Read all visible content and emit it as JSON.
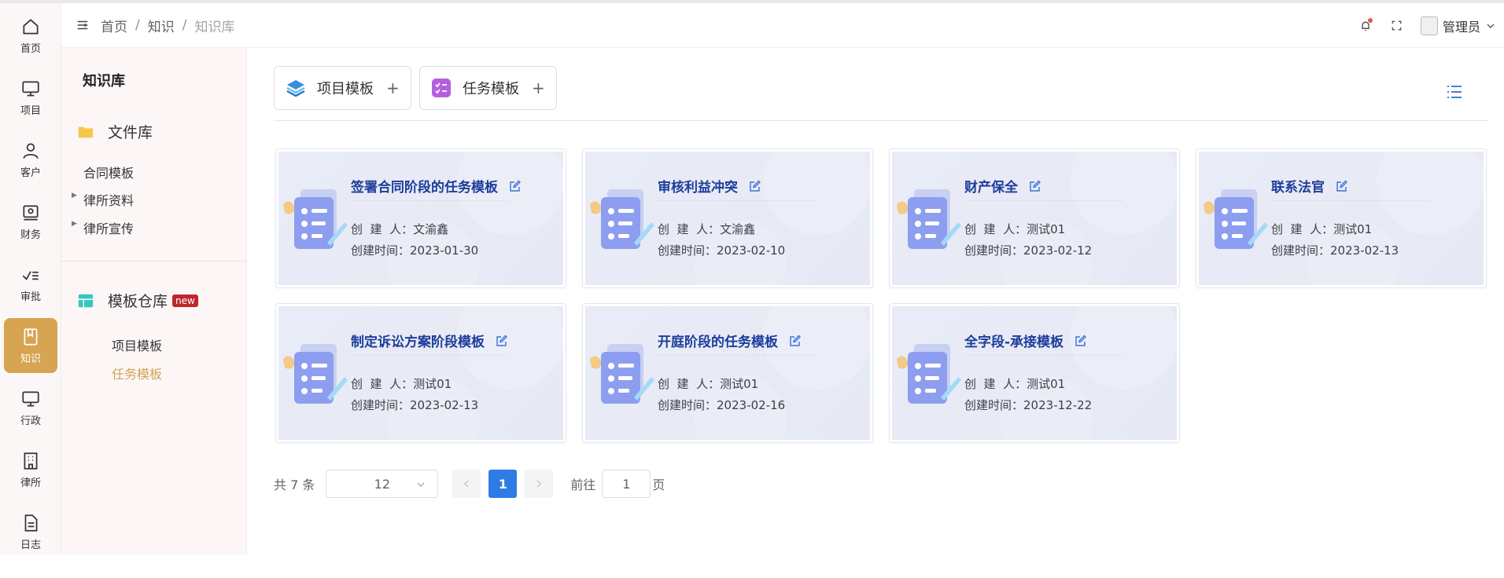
{
  "rail": [
    {
      "label": "首页",
      "icon": "home-icon"
    },
    {
      "label": "项目",
      "icon": "monitor-icon"
    },
    {
      "label": "客户",
      "icon": "user-icon"
    },
    {
      "label": "财务",
      "icon": "finance-icon"
    },
    {
      "label": "审批",
      "icon": "approval-icon"
    },
    {
      "label": "知识",
      "icon": "book-icon",
      "active": true
    },
    {
      "label": "行政",
      "icon": "monitor-icon"
    },
    {
      "label": "律所",
      "icon": "building-icon"
    },
    {
      "label": "日志",
      "icon": "document-icon"
    }
  ],
  "breadcrumb": {
    "items": [
      "首页",
      "知识",
      "知识库"
    ],
    "separator": "/"
  },
  "header": {
    "username": "管理员"
  },
  "side2": {
    "title": "知识库",
    "file_section": "文件库",
    "file_items": [
      "合同模板",
      "律所资料",
      "律所宣传"
    ],
    "template_section": "模板仓库",
    "new_badge": "new",
    "template_items": [
      "项目模板",
      "任务模板"
    ]
  },
  "toolbar": {
    "project_template": "项目模板",
    "task_template": "任务模板",
    "plus": "+"
  },
  "cards": [
    {
      "title": "签署合同阶段的任务模板",
      "creator_label": "创  建  人：",
      "creator": "文渝鑫",
      "time_label": "创建时间：",
      "time": "2023-01-30"
    },
    {
      "title": "审核利益冲突",
      "creator_label": "创  建  人：",
      "creator": "文渝鑫",
      "time_label": "创建时间：",
      "time": "2023-02-10"
    },
    {
      "title": "财产保全",
      "creator_label": "创  建  人：",
      "creator": "测试01",
      "time_label": "创建时间：",
      "time": "2023-02-12"
    },
    {
      "title": "联系法官",
      "creator_label": "创  建  人：",
      "creator": "测试01",
      "time_label": "创建时间：",
      "time": "2023-02-13"
    },
    {
      "title": "制定诉讼方案阶段模板",
      "creator_label": "创  建  人：",
      "creator": "测试01",
      "time_label": "创建时间：",
      "time": "2023-02-13"
    },
    {
      "title": "开庭阶段的任务模板",
      "creator_label": "创  建  人：",
      "creator": "测试01",
      "time_label": "创建时间：",
      "time": "2023-02-16"
    },
    {
      "title": "全字段-承接模板",
      "creator_label": "创  建  人：",
      "creator": "测试01",
      "time_label": "创建时间：",
      "time": "2023-12-22"
    }
  ],
  "pagination": {
    "total_text": "共 7 条",
    "page_size": "12",
    "current_page": "1",
    "goto_label": "前往",
    "goto_value": "1",
    "goto_suffix": "页"
  },
  "colors": {
    "accent": "#d7a452",
    "primary": "#2d7be5",
    "card_title": "#1d3d9b",
    "badge": "#c0262d"
  }
}
